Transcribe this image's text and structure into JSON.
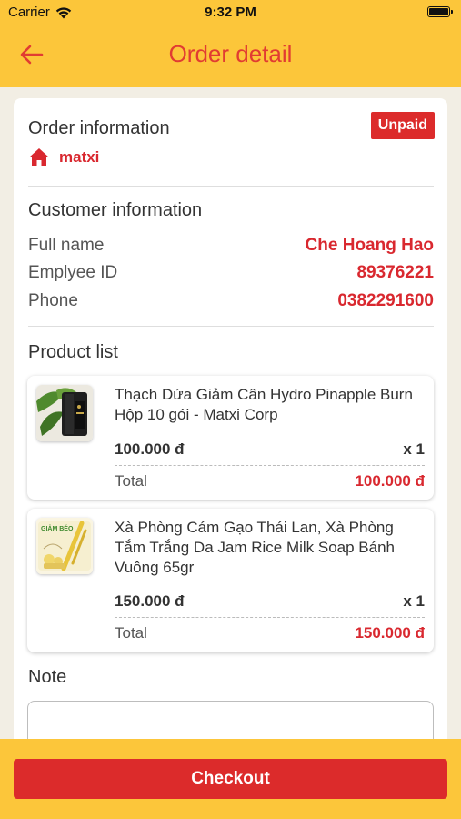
{
  "status_bar": {
    "carrier": "Carrier",
    "time": "9:32 PM"
  },
  "header": {
    "title": "Order detail",
    "back_icon": "arrow-left-icon"
  },
  "order_info": {
    "title": "Order information",
    "status": "Unpaid",
    "shop_name": "matxi",
    "shop_icon": "home-icon"
  },
  "customer": {
    "title": "Customer information",
    "rows": [
      {
        "label": "Full name",
        "value": "Che Hoang Hao"
      },
      {
        "label": "Emplyee ID",
        "value": "89376221"
      },
      {
        "label": "Phone",
        "value": "0382291600"
      }
    ]
  },
  "products": {
    "title": "Product list",
    "items": [
      {
        "name": "Thạch Dứa Giảm Cân Hydro Pinapple Burn Hộp 10 gói - Matxi Corp",
        "price": "100.000 đ",
        "qty": "x 1",
        "total_label": "Total",
        "total": "100.000 đ"
      },
      {
        "name": "Xà Phòng Cám Gạo Thái Lan, Xà Phòng Tắm Trắng Da Jam Rice Milk Soap Bánh Vuông 65gr",
        "price": "150.000 đ",
        "qty": "x 1",
        "total_label": "Total",
        "total": "150.000 đ",
        "thumb_text": "GIẢM BÉO"
      }
    ]
  },
  "note": {
    "title": "Note",
    "value": ""
  },
  "checkout": {
    "label": "Checkout"
  },
  "colors": {
    "primary_yellow": "#fcc63a",
    "accent_red": "#dc2b2b",
    "text_red": "#d9282f"
  }
}
